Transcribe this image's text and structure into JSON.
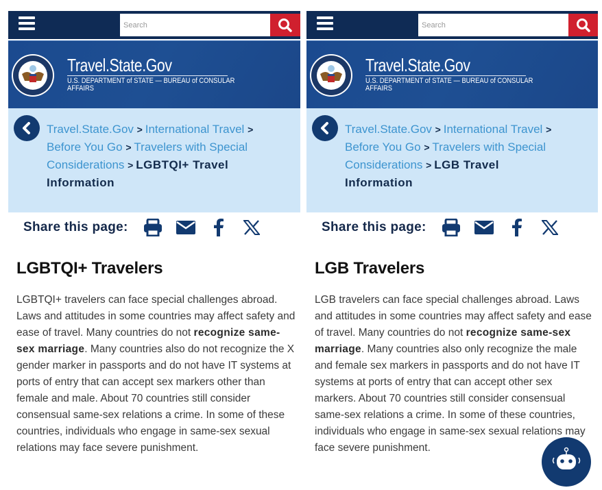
{
  "panels": [
    {
      "search": {
        "placeholder": "Search"
      },
      "site": {
        "title": "Travel.State.Gov",
        "subtitle": "U.S. DEPARTMENT of STATE — BUREAU of CONSULAR AFFAIRS"
      },
      "breadcrumb": {
        "items": [
          "Travel.State.Gov",
          "International Travel",
          "Before You Go",
          "Travelers with Special Considerations"
        ],
        "separator": ">",
        "current": "LGBTQI+ Travel Information"
      },
      "share": {
        "label": "Share this page:",
        "icons": [
          "print-icon",
          "email-icon",
          "facebook-icon",
          "x-twitter-icon"
        ]
      },
      "heading": "LGBTQI+ Travelers",
      "body": {
        "part1": "LGBTQI+ travelers can face special challenges abroad. Laws and attitudes in some countries may affect safety and ease of travel. Many countries do not ",
        "bold": "recognize same-sex marriage",
        "part2": ". Many countries also do not recognize the X gender marker in passports and do not have IT systems at ports of entry that can accept sex markers other than female and male. About 70 countries still consider consensual same-sex relations a crime. In some of these countries, individuals who engage in same-sex sexual relations may face severe punishment."
      }
    },
    {
      "search": {
        "placeholder": "Search"
      },
      "site": {
        "title": "Travel.State.Gov",
        "subtitle": "U.S. DEPARTMENT of STATE — BUREAU of CONSULAR AFFAIRS"
      },
      "breadcrumb": {
        "items": [
          "Travel.State.Gov",
          "International Travel",
          "Before You Go",
          "Travelers with Special Considerations"
        ],
        "separator": ">",
        "current": "LGB Travel Information"
      },
      "share": {
        "label": "Share this page:",
        "icons": [
          "print-icon",
          "email-icon",
          "facebook-icon",
          "x-twitter-icon"
        ]
      },
      "heading": "LGB Travelers",
      "body": {
        "part1": "LGB travelers can face special challenges abroad. Laws and attitudes in some countries may affect safety and ease of travel. Many countries do not ",
        "bold": "recognize same-sex marriage",
        "part2": ". Many countries also only recognize the male and female sex markers in passports and do not have IT systems at ports of entry that can accept other sex markers. About 70 countries still consider consensual same-sex relations a crime. In some of these countries, individuals who engage in same-sex sexual relations may face severe punishment."
      }
    }
  ],
  "chatbot": {
    "icon": "chatbot-robot-icon"
  },
  "colors": {
    "navy": "#0f2b55",
    "banner": "#1d4c91",
    "search_red": "#d0202e",
    "breadcrumb_bg": "#cfe6f8",
    "link": "#3d94cf"
  }
}
